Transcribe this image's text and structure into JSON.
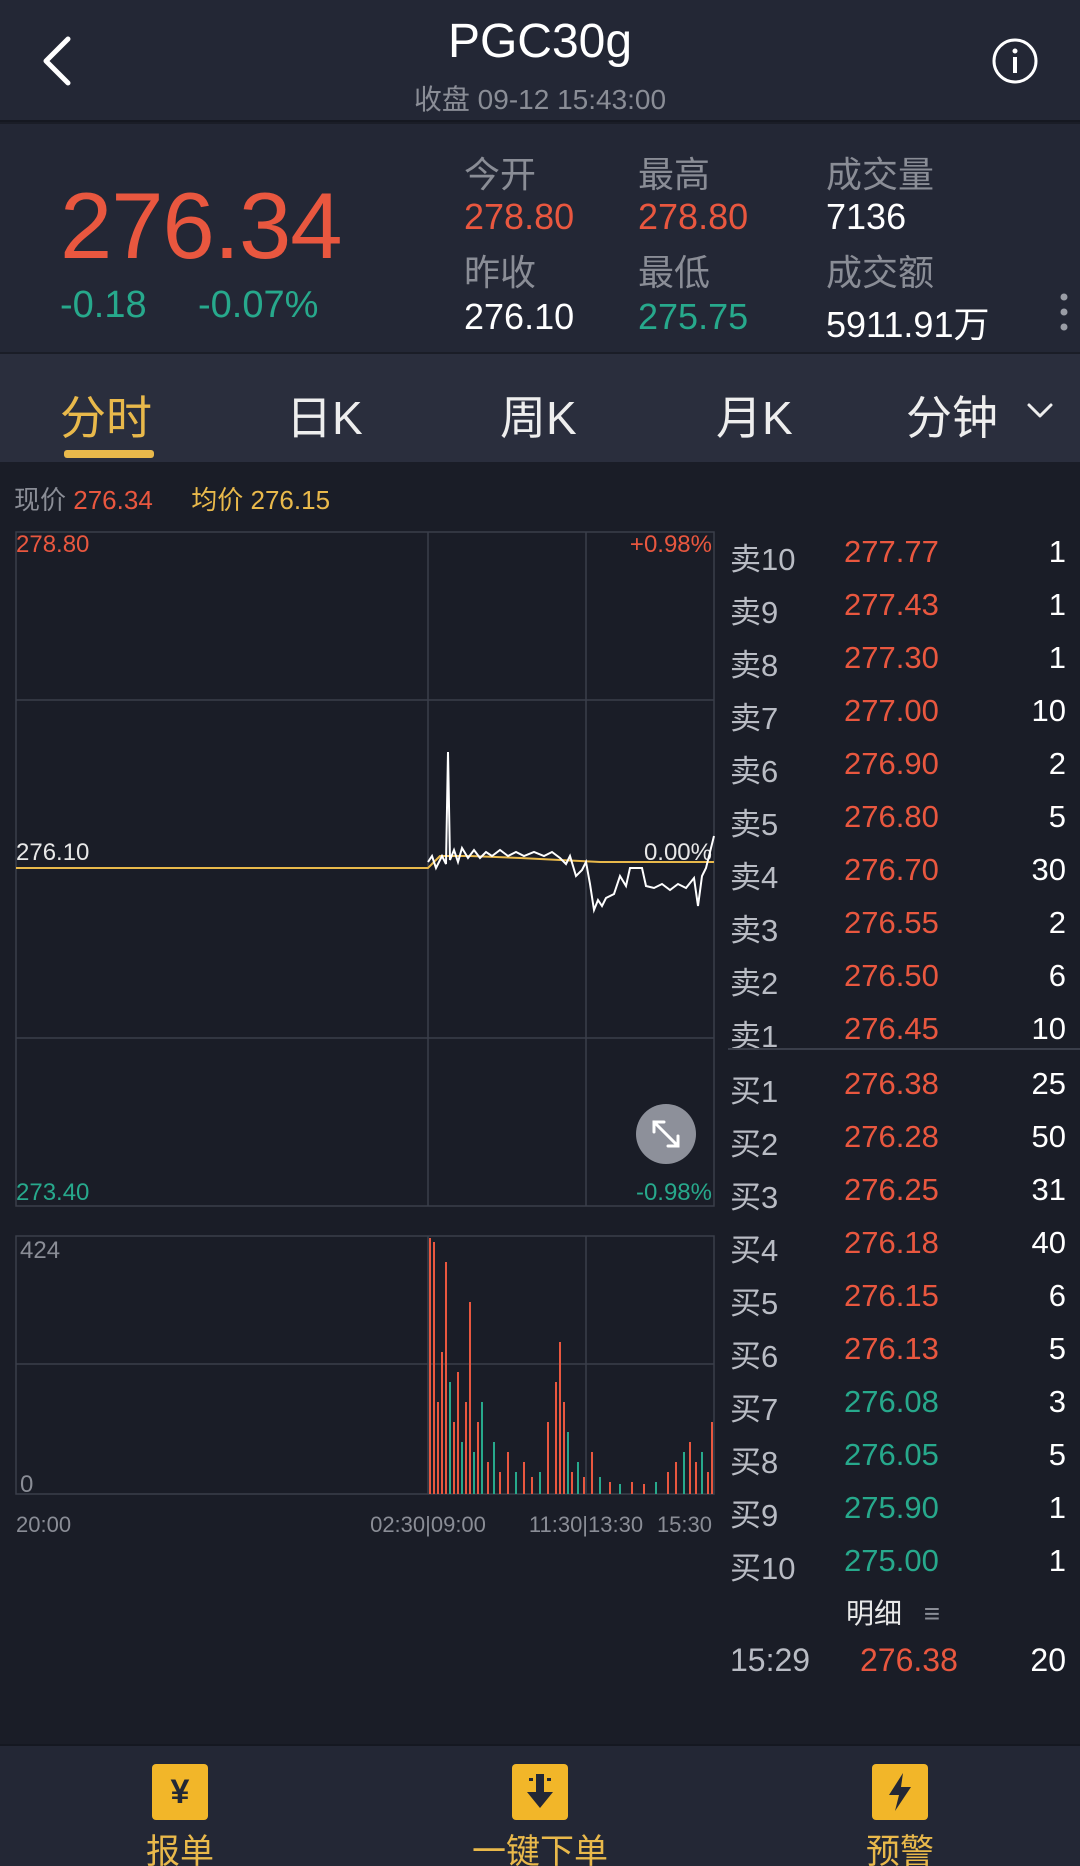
{
  "header": {
    "title": "PGC30g",
    "subtitle": "收盘 09-12 15:43:00"
  },
  "quote": {
    "price": "276.34",
    "change": "-0.18",
    "change_pct": "-0.07%",
    "open_label": "今开",
    "open": "278.80",
    "high_label": "最高",
    "high": "278.80",
    "volume_label": "成交量",
    "volume": "7136",
    "prev_close_label": "昨收",
    "prev_close": "276.10",
    "low_label": "最低",
    "low": "275.75",
    "amount_label": "成交额",
    "amount": "5911.91万"
  },
  "tabs": {
    "t1": "分时",
    "t2": "日K",
    "t3": "周K",
    "t4": "月K",
    "t5": "分钟"
  },
  "legend": {
    "now_label": "现价",
    "now": "276.34",
    "avg_label": "均价",
    "avg": "276.15"
  },
  "chart_labels": {
    "price_top": "278.80",
    "price_mid": "276.10",
    "price_bottom": "273.40",
    "pct_top": "+0.98%",
    "pct_mid": "0.00%",
    "pct_bottom": "-0.98%",
    "vol_top": "424",
    "vol_bottom": "0",
    "x1": "20:00",
    "x2": "02:30|09:00",
    "x3": "11:30|13:30",
    "x4": "15:30"
  },
  "orderbook": {
    "asks": [
      {
        "label": "卖10",
        "price": "277.77",
        "qty": "1"
      },
      {
        "label": "卖9",
        "price": "277.43",
        "qty": "1"
      },
      {
        "label": "卖8",
        "price": "277.30",
        "qty": "1"
      },
      {
        "label": "卖7",
        "price": "277.00",
        "qty": "10"
      },
      {
        "label": "卖6",
        "price": "276.90",
        "qty": "2"
      },
      {
        "label": "卖5",
        "price": "276.80",
        "qty": "5"
      },
      {
        "label": "卖4",
        "price": "276.70",
        "qty": "30"
      },
      {
        "label": "卖3",
        "price": "276.55",
        "qty": "2"
      },
      {
        "label": "卖2",
        "price": "276.50",
        "qty": "6"
      },
      {
        "label": "卖1",
        "price": "276.45",
        "qty": "10"
      }
    ],
    "bids": [
      {
        "label": "买1",
        "price": "276.38",
        "qty": "25"
      },
      {
        "label": "买2",
        "price": "276.28",
        "qty": "50"
      },
      {
        "label": "买3",
        "price": "276.25",
        "qty": "31"
      },
      {
        "label": "买4",
        "price": "276.18",
        "qty": "40"
      },
      {
        "label": "买5",
        "price": "276.15",
        "qty": "6"
      },
      {
        "label": "买6",
        "price": "276.13",
        "qty": "5"
      },
      {
        "label": "买7",
        "price": "276.08",
        "qty": "3"
      },
      {
        "label": "买8",
        "price": "276.05",
        "qty": "5"
      },
      {
        "label": "买9",
        "price": "275.90",
        "qty": "1"
      },
      {
        "label": "买10",
        "price": "275.00",
        "qty": "1"
      }
    ],
    "detail_label": "明细",
    "last_trade": {
      "time": "15:29",
      "price": "276.38",
      "qty": "20"
    }
  },
  "bottom_nav": {
    "order": "报单",
    "quick_order": "一键下单",
    "alert": "预警"
  },
  "colors": {
    "up": "#e9573f",
    "down": "#27a98c",
    "accent": "#e9b94b",
    "bg": "#1a1d27"
  }
}
